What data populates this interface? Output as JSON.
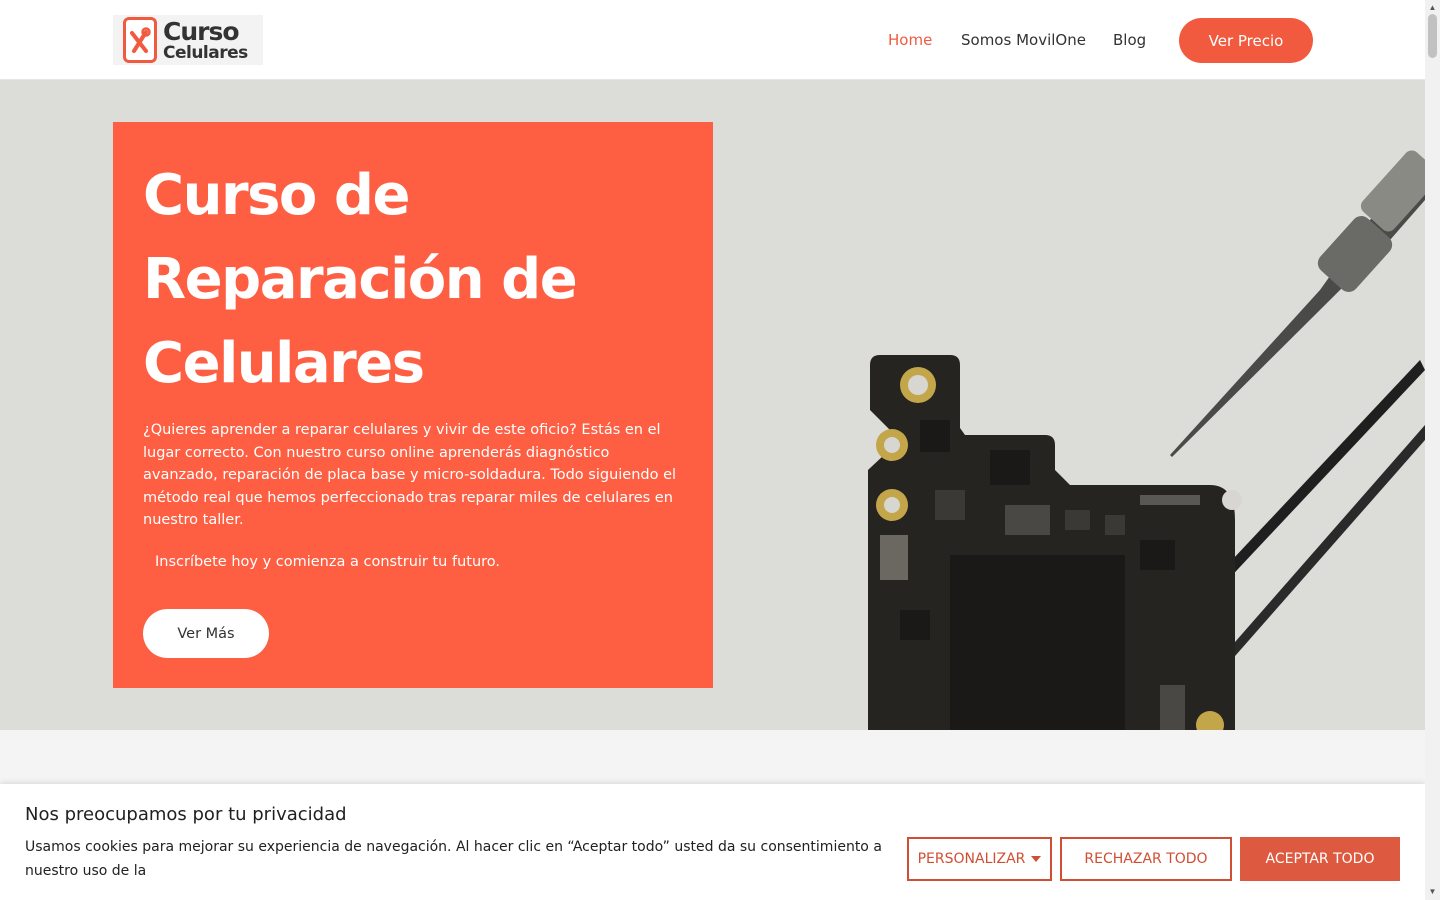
{
  "header": {
    "logo": {
      "line1": "Curso",
      "line2": "Celulares",
      "icon": "phone-tools-icon"
    },
    "nav": [
      {
        "label": "Home",
        "active": true
      },
      {
        "label": "Somos MovilOne",
        "active": false
      },
      {
        "label": "Blog",
        "active": false
      }
    ],
    "cta_label": "Ver Precio"
  },
  "hero": {
    "title_lines": [
      "Curso de",
      "Reparación de",
      "Celulares"
    ],
    "description": "¿Quieres aprender a reparar celulares y vivir de este oficio? Estás en el lugar correcto. Con nuestro curso online aprenderás diagnóstico avanzado, reparación de placa base y micro-soldadura. Todo siguiendo el método real que hemos perfeccionado tras reparar miles de celulares en nuestro taller.",
    "cta_text": "Inscríbete hoy y comienza a construir tu futuro.",
    "button_label": "Ver Más",
    "image": "circuit-board-with-tweezers"
  },
  "cookie": {
    "title": "Nos preocupamos por tu privacidad",
    "text": "Usamos cookies para mejorar su experiencia de navegación. Al hacer clic en “Aceptar todo” usted da su consentimiento a nuestro uso de la",
    "personalize_label": "PERSONALIZAR",
    "reject_label": "RECHAZAR TODO",
    "accept_label": "ACEPTAR TODO"
  },
  "colors": {
    "accent": "#fe5e42",
    "nav_active": "#f15a3f",
    "cookie_border": "#d04e34",
    "hero_bg": "#dcdcd8"
  }
}
